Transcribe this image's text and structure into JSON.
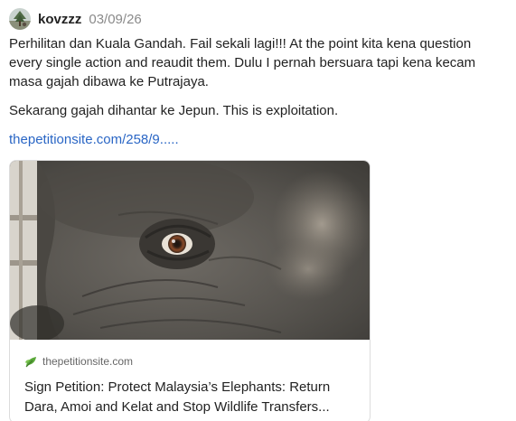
{
  "post": {
    "username": "kovzzz",
    "date": "03/09/26",
    "paragraph1": "Perhilitan dan Kuala Gandah. Fail sekali lagi!!! At the point kita kena question every single action and reaudit them. Dulu I pernah bersuara tapi kena kecam masa gajah dibawa ke Putrajaya.",
    "paragraph2": "Sekarang gajah dihantar ke Jepun. This is exploitation.",
    "link_text": "thepetitionsite.com/258/9....."
  },
  "link_card": {
    "site_name": "thepetitionsite.com",
    "title_line1": "Sign Petition: Protect Malaysia’s Elephants: Return",
    "title_line2": "Dara, Amoi and Kelat and Stop Wildlife Transfers..."
  },
  "icons": {
    "avatar": "avatar-icon",
    "site": "leaf-icon"
  },
  "colors": {
    "link": "#2a66c5",
    "date": "#8a8a8a",
    "site_icon": "#5aa83a"
  }
}
